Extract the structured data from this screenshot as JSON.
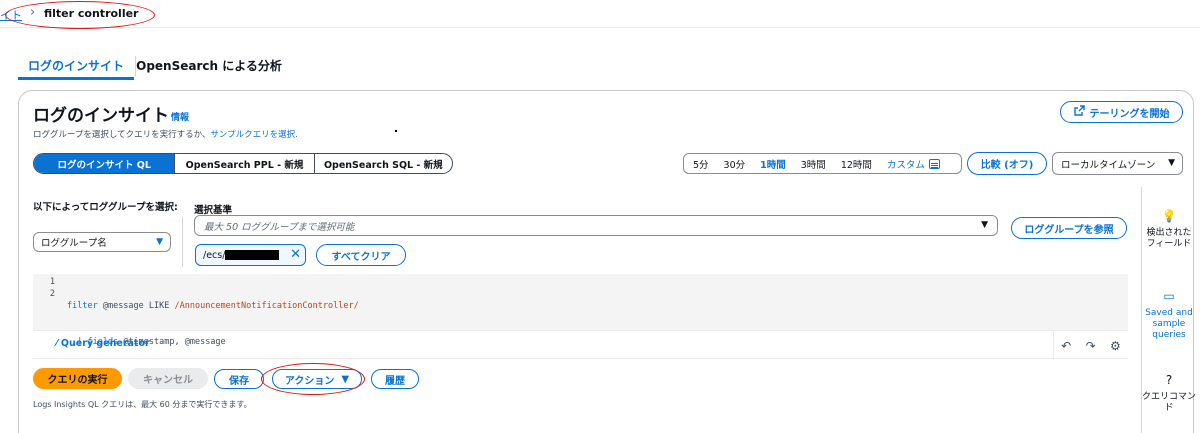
{
  "breadcrumb": {
    "prev": "イト",
    "separator": "›",
    "current": "filter controller"
  },
  "tabs": [
    "ログのインサイト",
    "OpenSearch による分析"
  ],
  "header": {
    "title": "ログのインサイト",
    "info": "情報",
    "description_prefix": "ロググループを選択してクエリを実行するか、",
    "description_link": "サンプルクエリを選択.",
    "tail_button": "テーリングを開始"
  },
  "query_languages": [
    "ログのインサイト QL",
    "OpenSearch PPL - 新規",
    "OpenSearch SQL - 新規"
  ],
  "time_range": {
    "options": [
      "5分",
      "30分",
      "1時間",
      "3時間",
      "12時間"
    ],
    "selected": "1時間",
    "custom": "カスタム"
  },
  "compare_button": "比較 (オフ)",
  "timezone": "ローカルタイムゾーン",
  "selection": {
    "mode_label": "以下によってロググループを選択:",
    "mode_value": "ロググループ名",
    "criteria_label": "選択基準",
    "placeholder": "最大 50 ロググループまで選択可能",
    "browse_button": "ロググループを参照",
    "token_prefix": "/ecs/",
    "clear_all": "すべてクリア"
  },
  "editor": {
    "line_numbers": [
      "1",
      "2"
    ],
    "line1": {
      "kw": "filter",
      "rest": " @message LIKE ",
      "str": "/AnnouncementNotificationController/"
    },
    "line2": {
      "pipe": "  | ",
      "kw": "fields",
      "rest": " @timestamp, @message"
    },
    "query_generator": "Query generator"
  },
  "side_panel": {
    "discovered_fields": "検出されたフィールド",
    "saved_queries": "Saved and sample queries",
    "query_commands": "クエリコマンド"
  },
  "actions": {
    "run": "クエリの実行",
    "cancel": "キャンセル",
    "save": "保存",
    "action": "アクション",
    "history": "履歴"
  },
  "footer_note": "Logs Insights QL クエリは、最大 60 分まで実行できます。",
  "colors": {
    "accent": "#0972d3",
    "run": "#ff9900",
    "annotation": "#d91515"
  }
}
